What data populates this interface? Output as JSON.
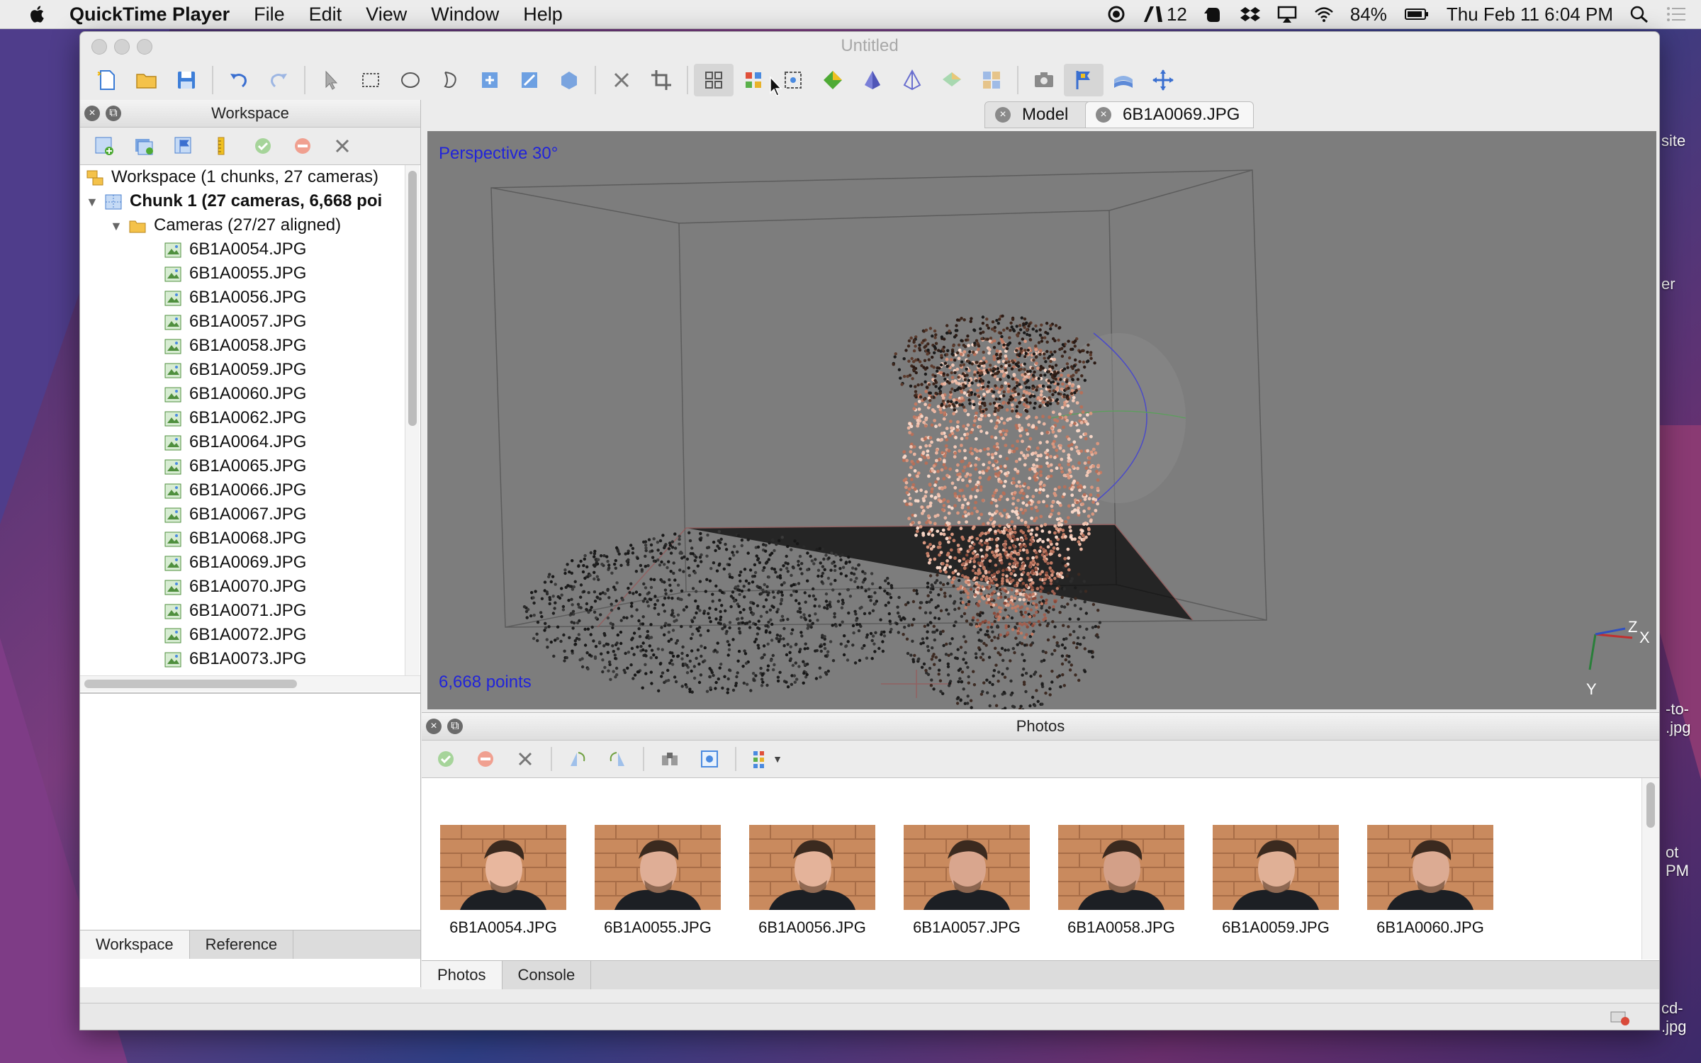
{
  "menubar": {
    "app_name": "QuickTime Player",
    "items": [
      "File",
      "Edit",
      "View",
      "Window",
      "Help"
    ],
    "status_count": "12",
    "battery": "84%",
    "datetime": "Thu Feb 11  6:04 PM"
  },
  "window": {
    "title": "Untitled",
    "toolbar_icons": [
      "new-doc-icon",
      "open-folder-icon",
      "save-icon",
      "undo-icon",
      "redo-icon",
      "pointer-icon",
      "rect-select-icon",
      "circle-select-icon",
      "free-select-icon",
      "rotate-icon",
      "rotate-view-icon",
      "navigation-icon",
      "delete-icon",
      "crop-icon",
      "point-cloud-icon",
      "dense-cloud-icon",
      "tiled-icon",
      "solid-mesh-icon",
      "shaded-mesh-icon",
      "wireframe-icon",
      "textured-icon",
      "reset-view-icon",
      "cameras-icon",
      "markers-icon",
      "shapes-icon",
      "pan-icon"
    ]
  },
  "workspace": {
    "panel_title": "Workspace",
    "root": "Workspace (1 chunks, 27 cameras)",
    "chunk": "Chunk 1 (27 cameras, 6,668 poi",
    "cameras_folder": "Cameras (27/27 aligned)",
    "cameras": [
      "6B1A0054.JPG",
      "6B1A0055.JPG",
      "6B1A0056.JPG",
      "6B1A0057.JPG",
      "6B1A0058.JPG",
      "6B1A0059.JPG",
      "6B1A0060.JPG",
      "6B1A0062.JPG",
      "6B1A0064.JPG",
      "6B1A0065.JPG",
      "6B1A0066.JPG",
      "6B1A0067.JPG",
      "6B1A0068.JPG",
      "6B1A0069.JPG",
      "6B1A0070.JPG",
      "6B1A0071.JPG",
      "6B1A0072.JPG",
      "6B1A0073.JPG"
    ],
    "tabs": [
      "Workspace",
      "Reference"
    ]
  },
  "doc_tabs": [
    "Model",
    "6B1A0069.JPG"
  ],
  "viewport": {
    "projection": "Perspective 30°",
    "points": "6,668 points",
    "axes": {
      "x": "X",
      "y": "Y",
      "z": "Z"
    }
  },
  "photos": {
    "panel_title": "Photos",
    "items": [
      "6B1A0054.JPG",
      "6B1A0055.JPG",
      "6B1A0056.JPG",
      "6B1A0057.JPG",
      "6B1A0058.JPG",
      "6B1A0059.JPG",
      "6B1A0060.JPG"
    ],
    "tabs": [
      "Photos",
      "Console"
    ]
  },
  "colors": {
    "viewport_bg": "#7d7d7d",
    "label_blue": "#2124d9"
  }
}
